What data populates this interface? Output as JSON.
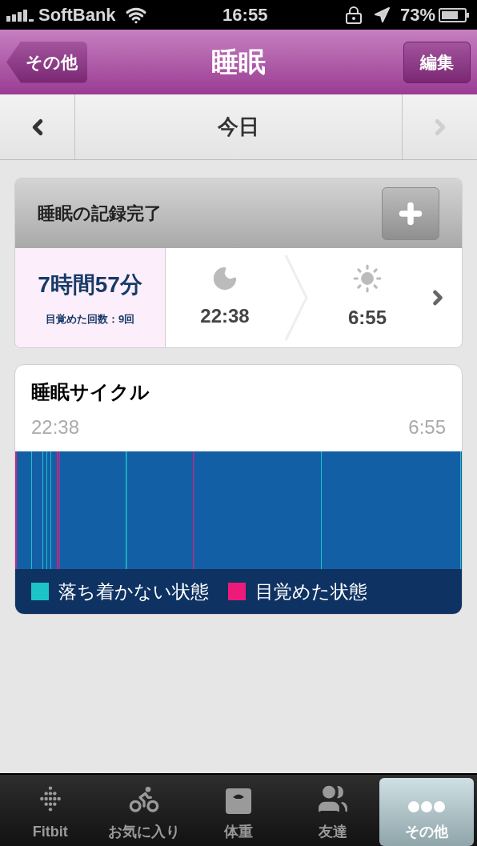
{
  "status_bar": {
    "carrier": "SoftBank",
    "time": "16:55",
    "battery": "73%"
  },
  "nav_bar": {
    "back": "その他",
    "title": "睡眠",
    "edit": "編集"
  },
  "date_bar": {
    "label": "今日",
    "next_disabled": true
  },
  "summary_card": {
    "title": "睡眠の記録完了",
    "duration": "7時間57分",
    "awakenings": "目覚めた回数：9回",
    "bedtime": "22:38",
    "wake_time": "6:55"
  },
  "cycle_card": {
    "title": "睡眠サイクル",
    "start": "22:38",
    "end": "6:55",
    "legend": [
      {
        "label": "落ち着かない状態",
        "color": "#1cc4c8"
      },
      {
        "label": "目覚めた状態",
        "color": "#ee1a7a"
      }
    ]
  },
  "tab_bar": [
    {
      "label": "Fitbit",
      "selected": false
    },
    {
      "label": "お気に入り",
      "selected": false
    },
    {
      "label": "体重",
      "selected": false
    },
    {
      "label": "友達",
      "selected": false
    },
    {
      "label": "その他",
      "selected": true
    }
  ]
}
